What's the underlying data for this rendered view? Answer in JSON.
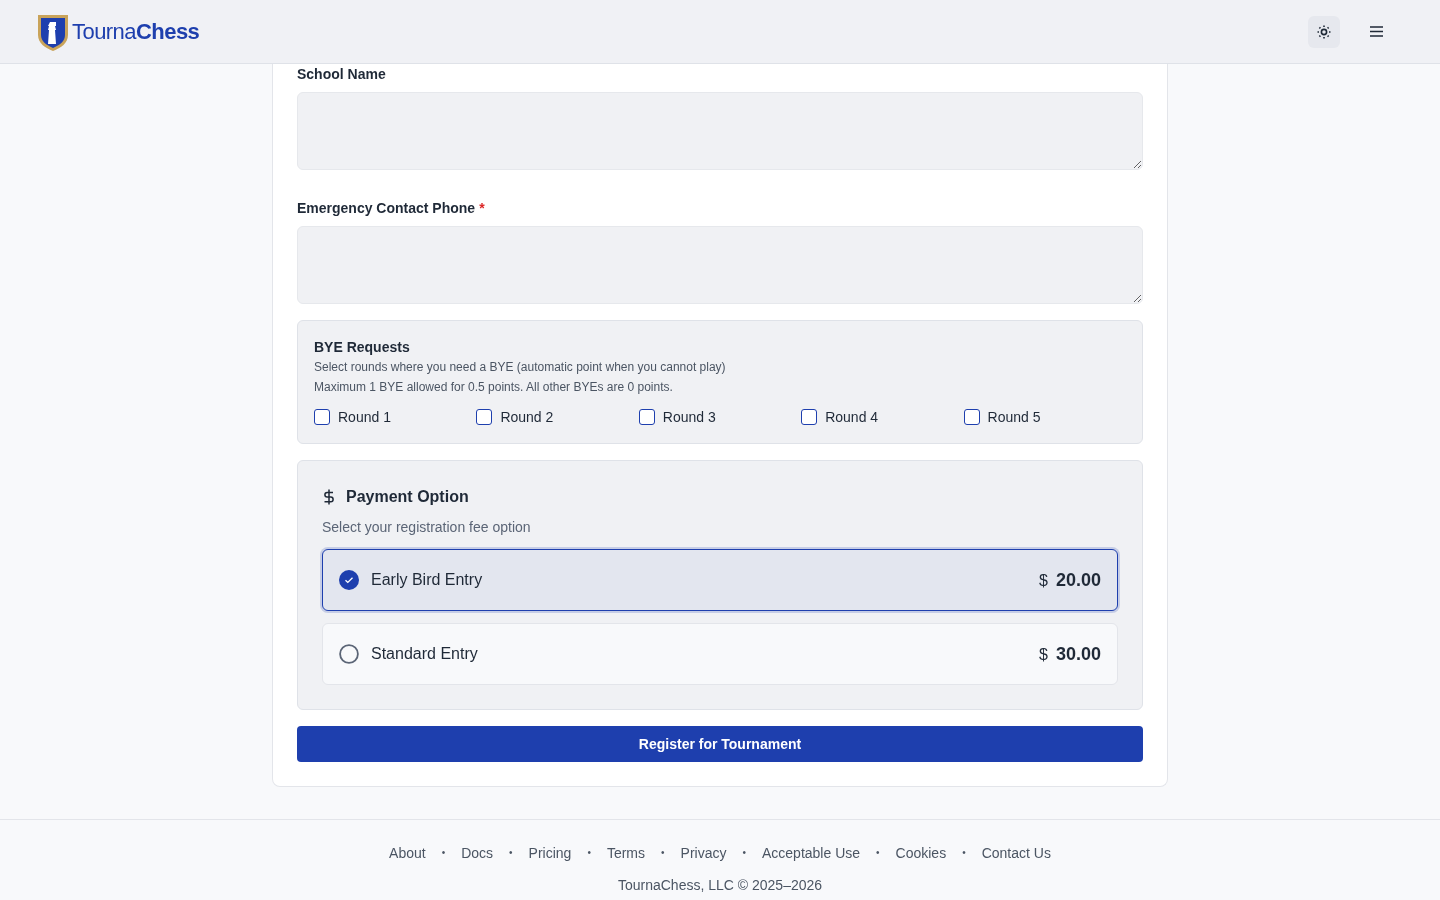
{
  "header": {
    "logo_parts": [
      "Tourna",
      "Chess"
    ]
  },
  "fields": [
    {
      "label": "School Name",
      "required": false
    },
    {
      "label": "Emergency Contact Phone",
      "required": true
    }
  ],
  "required_marker": "*",
  "bye": {
    "title": "BYE Requests",
    "lines": [
      "Select rounds where you need a BYE (automatic point when you cannot play)",
      "Maximum 1 BYE allowed for 0.5 points. All other BYEs are 0 points."
    ],
    "rounds": [
      {
        "label": "Round 1",
        "checked": false
      },
      {
        "label": "Round 2",
        "checked": false
      },
      {
        "label": "Round 3",
        "checked": false
      },
      {
        "label": "Round 4",
        "checked": false
      },
      {
        "label": "Round 5",
        "checked": false
      }
    ]
  },
  "payment": {
    "title": "Payment Option",
    "subtitle": "Select your registration fee option",
    "options": [
      {
        "label": "Early Bird Entry",
        "currency": "$",
        "amount": "20.00",
        "selected": true
      },
      {
        "label": "Standard Entry",
        "currency": "$",
        "amount": "30.00",
        "selected": false
      }
    ]
  },
  "submit": "Register for Tournament",
  "footer": {
    "links": [
      "About",
      "Docs",
      "Pricing",
      "Terms",
      "Privacy",
      "Acceptable Use",
      "Cookies",
      "Contact Us"
    ],
    "separator": "•",
    "copyright": "TournaChess, LLC © 2025–2026"
  }
}
